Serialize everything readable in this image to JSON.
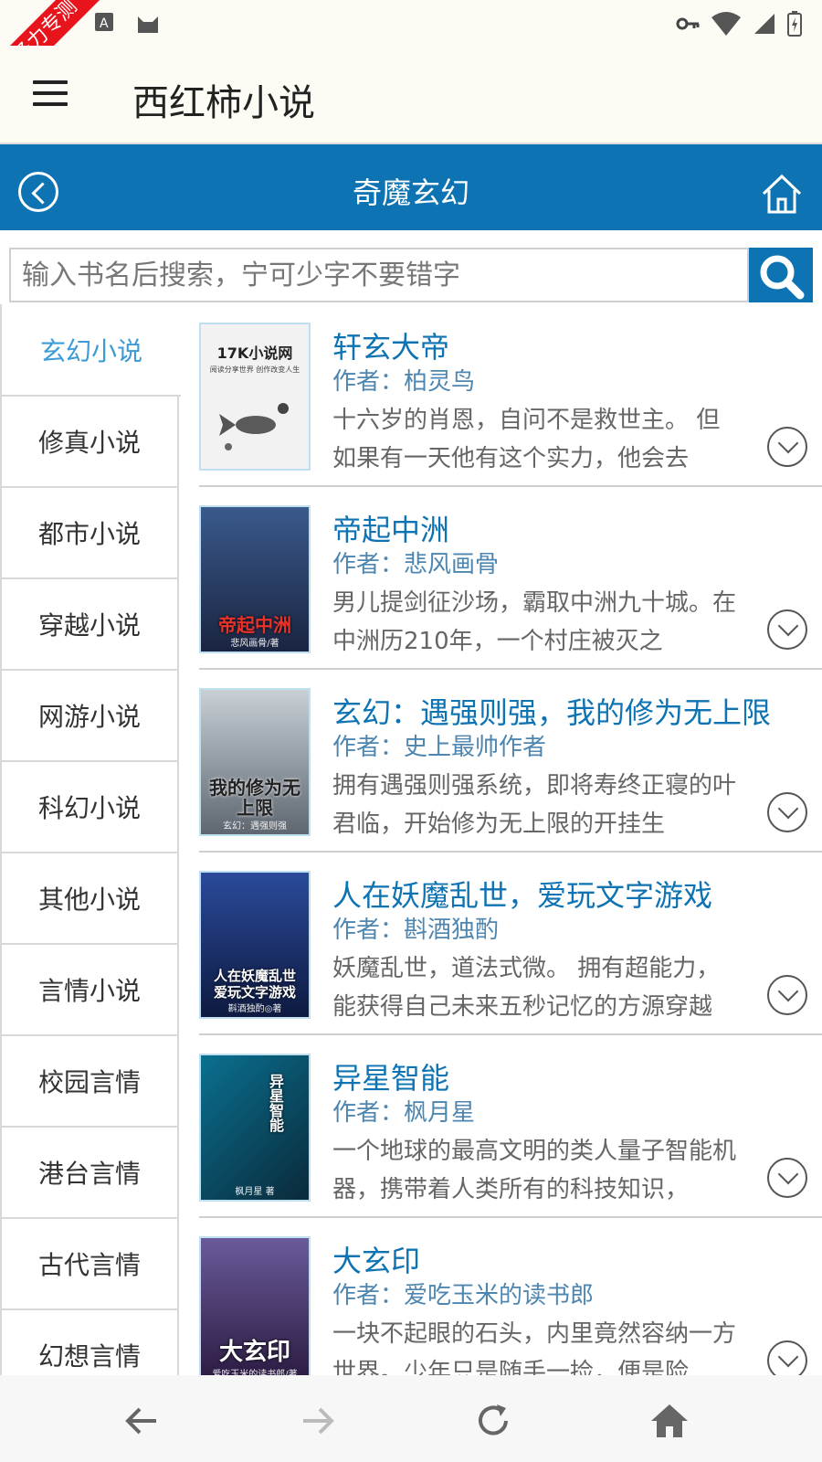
{
  "status_bar": {
    "ribbon_text": "圣力专测"
  },
  "app_bar": {
    "title": "西红柿小说"
  },
  "category_header": {
    "title": "奇魔玄幻"
  },
  "search": {
    "placeholder": "输入书名后搜索，宁可少字不要错字"
  },
  "sidebar": {
    "items": [
      {
        "label": "玄幻小说",
        "active": true
      },
      {
        "label": "修真小说"
      },
      {
        "label": "都市小说"
      },
      {
        "label": "穿越小说"
      },
      {
        "label": "网游小说"
      },
      {
        "label": "科幻小说"
      },
      {
        "label": "其他小说"
      },
      {
        "label": "言情小说"
      },
      {
        "label": "校园言情"
      },
      {
        "label": "港台言情"
      },
      {
        "label": "古代言情"
      },
      {
        "label": "幻想言情"
      }
    ]
  },
  "books": [
    {
      "title": "轩玄大帝",
      "author": "作者：柏灵鸟",
      "desc": "十六岁的肖恩，自问不是救世主。 但如果有一天他有这个实力，他会去",
      "cover_top": "17K小说网",
      "cover_sub": "阅读分享世界 创作改变人生",
      "cover_color": "#f2f2f2"
    },
    {
      "title": "帝起中洲",
      "author": "作者：悲风画骨",
      "desc": "男儿提剑征沙场，霸取中洲九十城。在中洲历210年，一个村庄被灭之",
      "cover_text": "帝起中洲",
      "cover_author": "悲风画骨/著",
      "cover_color": "#2b3f6a"
    },
    {
      "title": "玄幻：遇强则强，我的修为无上限",
      "author": "作者：史上最帅作者",
      "desc": "拥有遇强则强系统，即将寿终正寝的叶君临，开始修为无上限的开挂生",
      "cover_text": "我的修为无上限",
      "cover_author": "玄幻：遇强则强",
      "cover_color": "#9aa4ac"
    },
    {
      "title": "人在妖魔乱世，爱玩文字游戏",
      "author": "作者：斟酒独酌",
      "desc": "妖魔乱世，道法式微。 拥有超能力，能获得自己未来五秒记忆的方源穿越",
      "cover_text": "人在妖魔乱世 爱玩文字游戏",
      "cover_author": "斟酒独酌◎著",
      "cover_color": "#1d3a78"
    },
    {
      "title": "异星智能",
      "author": "作者：枫月星",
      "desc": "一个地球的最高文明的类人量子智能机器，携带着人类所有的科技知识，",
      "cover_text": "异星智能",
      "cover_author": "枫月星 著",
      "cover_color": "#0d5a70"
    },
    {
      "title": "大玄印",
      "author": "作者：爱吃玉米的读书郎",
      "desc": "一块不起眼的石头，内里竟然容纳一方世界。少年只是随手一捡，便是险",
      "cover_text": "大玄印",
      "cover_author": "爱吃玉米的读书郎/著",
      "cover_color": "#4a3a6a"
    }
  ],
  "colors": {
    "primary": "#0e73b2",
    "active_category": "#3c9bd6",
    "ribbon": "#e8141c"
  }
}
